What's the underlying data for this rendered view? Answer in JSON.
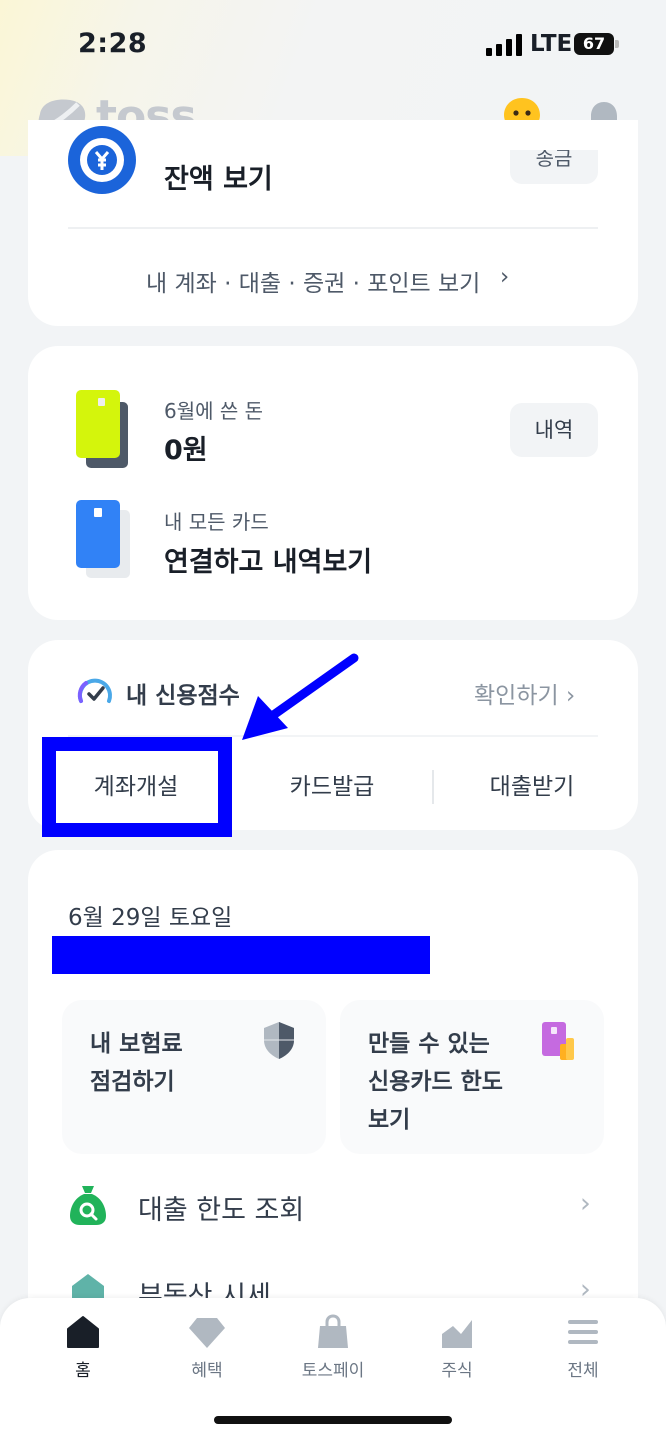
{
  "status_bar": {
    "time": "2:28",
    "network": "LTE",
    "battery": "67"
  },
  "header": {
    "logo_text": "toss"
  },
  "account_card": {
    "balance_label": "잔액 보기",
    "send_button": "송금",
    "links": "내 계좌 · 대출 · 증권 · 포인트 보기",
    "chevron": "›"
  },
  "spend_card": {
    "month_label": "6월에 쓴 돈",
    "month_amount": "0원",
    "history_button": "내역",
    "all_cards_label": "내 모든 카드",
    "all_cards_link": "연결하고 내역보기"
  },
  "credit_card": {
    "title": "내 신용점수",
    "check": "확인하기 ›",
    "actions": [
      "계좌개설",
      "카드발급",
      "대출받기"
    ]
  },
  "daily_card": {
    "date": "6월 29일 토요일",
    "tiles": [
      {
        "lines": [
          "내 보험료",
          "점검하기"
        ]
      },
      {
        "lines": [
          "만들 수 있는",
          "신용카드 한도",
          "보기"
        ]
      }
    ],
    "list": [
      {
        "label": "대출 한도 조회",
        "chevron": "›"
      },
      {
        "label": "부동산 시세",
        "chevron": "›"
      }
    ]
  },
  "tabbar": {
    "tabs": [
      {
        "label": "홈",
        "icon": "home-icon"
      },
      {
        "label": "혜택",
        "icon": "diamond-icon"
      },
      {
        "label": "토스페이",
        "icon": "shopping-bag-icon"
      },
      {
        "label": "주식",
        "icon": "stock-chart-icon"
      },
      {
        "label": "전체",
        "icon": "menu-icon"
      }
    ]
  },
  "colors": {
    "brand_blue": "#3182f6",
    "annotation_blue": "#0000ff",
    "background": "#f2f4f6",
    "lime_card": "#d4f50c"
  }
}
